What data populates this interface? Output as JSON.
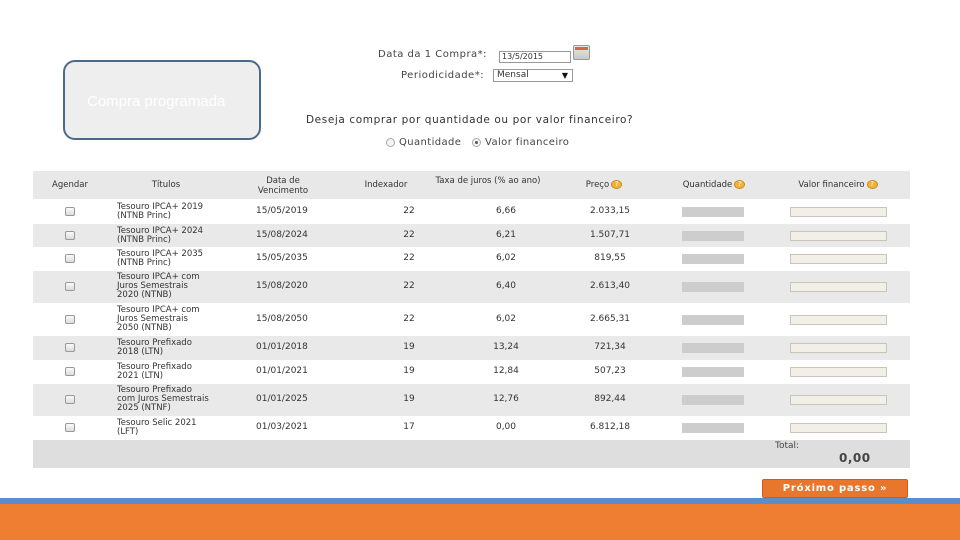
{
  "callout": {
    "text": "Compra programada"
  },
  "form": {
    "first_purchase_label": "Data da 1 Compra*:",
    "first_purchase_value": "13/5/2015",
    "periodicity_label": "Periodicidade*:",
    "periodicity_value": "Mensal",
    "question": "Deseja comprar por quantidade ou por valor financeiro?",
    "radio_quantity": "Quantidade",
    "radio_financial": "Valor financeiro",
    "selected_option": "Valor financeiro"
  },
  "table": {
    "headers": {
      "schedule": "Agendar",
      "title": "Títulos",
      "maturity": "Data de Vencimento",
      "index": "Indexador",
      "rate": "Taxa de juros (% ao ano)",
      "price": "Preço",
      "quantity": "Quantidade",
      "financial": "Valor financeiro"
    },
    "rows": [
      {
        "title1": "Tesouro IPCA+ 2019",
        "title2": "(NTNB Princ)",
        "title3": "",
        "date": "15/05/2019",
        "index": "22",
        "rate": "6,66",
        "price": "2.033,15"
      },
      {
        "title1": "Tesouro IPCA+ 2024",
        "title2": "(NTNB Princ)",
        "title3": "",
        "date": "15/08/2024",
        "index": "22",
        "rate": "6,21",
        "price": "1.507,71"
      },
      {
        "title1": "Tesouro IPCA+ 2035",
        "title2": "(NTNB Princ)",
        "title3": "",
        "date": "15/05/2035",
        "index": "22",
        "rate": "6,02",
        "price": "819,55"
      },
      {
        "title1": "Tesouro IPCA+ com",
        "title2": "Juros Semestrais",
        "title3": "2020 (NTNB)",
        "date": "15/08/2020",
        "index": "22",
        "rate": "6,40",
        "price": "2.613,40"
      },
      {
        "title1": "Tesouro IPCA+ com",
        "title2": "Juros Semestrais",
        "title3": "2050 (NTNB)",
        "date": "15/08/2050",
        "index": "22",
        "rate": "6,02",
        "price": "2.665,31"
      },
      {
        "title1": "Tesouro Prefixado",
        "title2": "2018 (LTN)",
        "title3": "",
        "date": "01/01/2018",
        "index": "19",
        "rate": "13,24",
        "price": "721,34"
      },
      {
        "title1": "Tesouro Prefixado",
        "title2": "2021 (LTN)",
        "title3": "",
        "date": "01/01/2021",
        "index": "19",
        "rate": "12,84",
        "price": "507,23"
      },
      {
        "title1": "Tesouro Prefixado",
        "title2": "com Juros Semestrais",
        "title3": "2025 (NTNF)",
        "date": "01/01/2025",
        "index": "19",
        "rate": "12,76",
        "price": "892,44"
      },
      {
        "title1": "Tesouro Selic 2021",
        "title2": "(LFT)",
        "title3": "",
        "date": "01/03/2021",
        "index": "17",
        "rate": "0,00",
        "price": "6.812,18"
      }
    ],
    "total_label": "Total:",
    "total_value": "0,00"
  },
  "help_icon_glyph": "?",
  "next_button": "Próximo passo »",
  "colors": {
    "accent": "#ef7d32",
    "band": "#5b8ec9",
    "callout_border": "#4a6a8c"
  }
}
